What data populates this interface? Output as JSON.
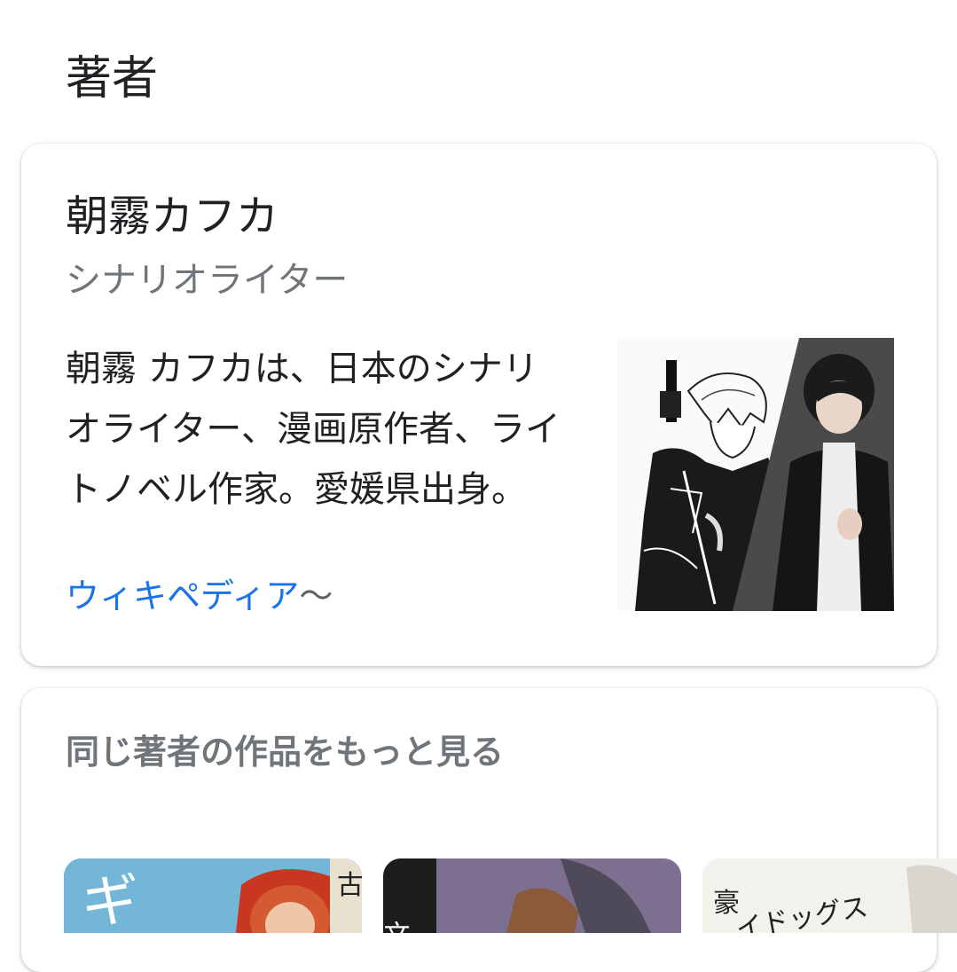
{
  "section": {
    "title": "著者"
  },
  "author": {
    "name": "朝霧カフカ",
    "role": "シナリオライター",
    "description": "朝霧 カフカは、日本のシナリオライター、漫画原作者、ライトノベル作家。愛媛県出身。",
    "wiki_link": "ウィキペディア",
    "wiki_chevron": "〜",
    "photo_alt": "朝霧カフカ"
  },
  "more_by_author": {
    "title": "同じ著者の作品をもっと見る",
    "books": [
      {
        "cover_text": "ギ",
        "side_text": "古"
      },
      {
        "cover_text": "文豪"
      },
      {
        "cover_text": "豪",
        "side_text": "イドッグス"
      }
    ]
  },
  "colors": {
    "link": "#1a73e8",
    "secondary_text": "#70757a",
    "primary_text": "#202124"
  }
}
